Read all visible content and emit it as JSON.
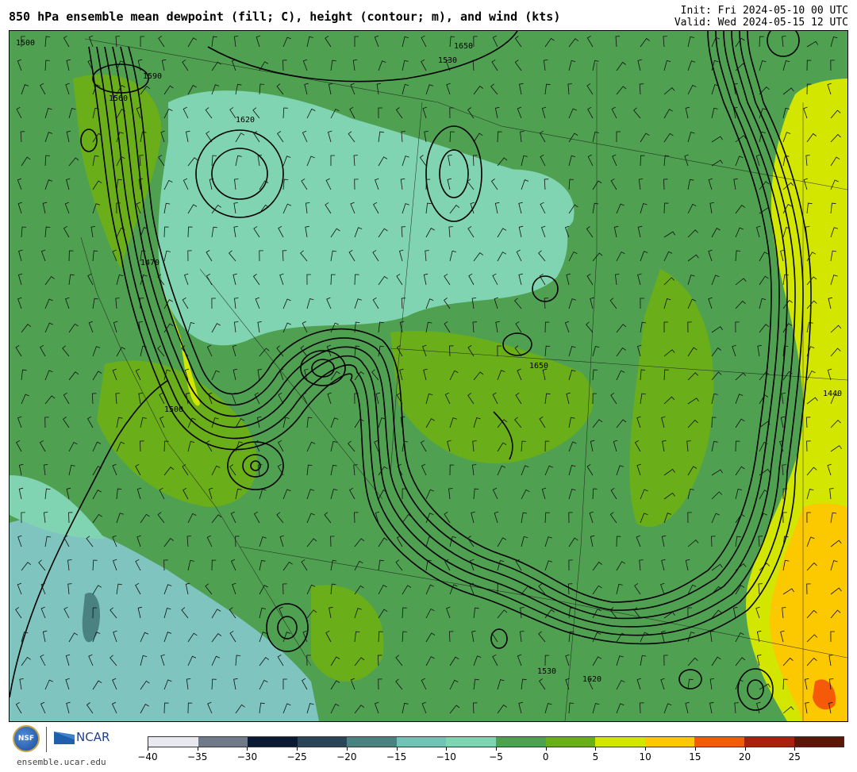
{
  "title": "850 hPa ensemble mean dewpoint (fill; C), height (contour; m), and wind (kts)",
  "init": "Init: Fri 2024-05-10 00 UTC",
  "valid": "Valid: Wed 2024-05-15 12 UTC",
  "site": "ensemble.ucar.edu",
  "logos": {
    "nsf": "NSF",
    "ncar": "NCAR"
  },
  "colorbar": {
    "colors": [
      "#e8e8f0",
      "#6e7a8a",
      "#0b1a34",
      "#2a4458",
      "#4a8282",
      "#72c2b6",
      "#80d4b2",
      "#4fa151",
      "#6aae1a",
      "#d2e600",
      "#fcc800",
      "#f45a08",
      "#a8200e",
      "#5a1606"
    ],
    "ticks": [
      "−40",
      "−35",
      "−30",
      "−25",
      "−20",
      "−15",
      "−10",
      "−5",
      "0",
      "5",
      "10",
      "15",
      "20",
      "25"
    ]
  },
  "contour_labels": [
    {
      "text": "1500"
    },
    {
      "text": "1560"
    },
    {
      "text": "1620"
    },
    {
      "text": "1530"
    },
    {
      "text": "1650"
    },
    {
      "text": "1590"
    },
    {
      "text": "1470"
    },
    {
      "text": "1440"
    },
    {
      "text": "1650"
    },
    {
      "text": "1620"
    },
    {
      "text": "1530"
    },
    {
      "text": "1500"
    }
  ]
}
